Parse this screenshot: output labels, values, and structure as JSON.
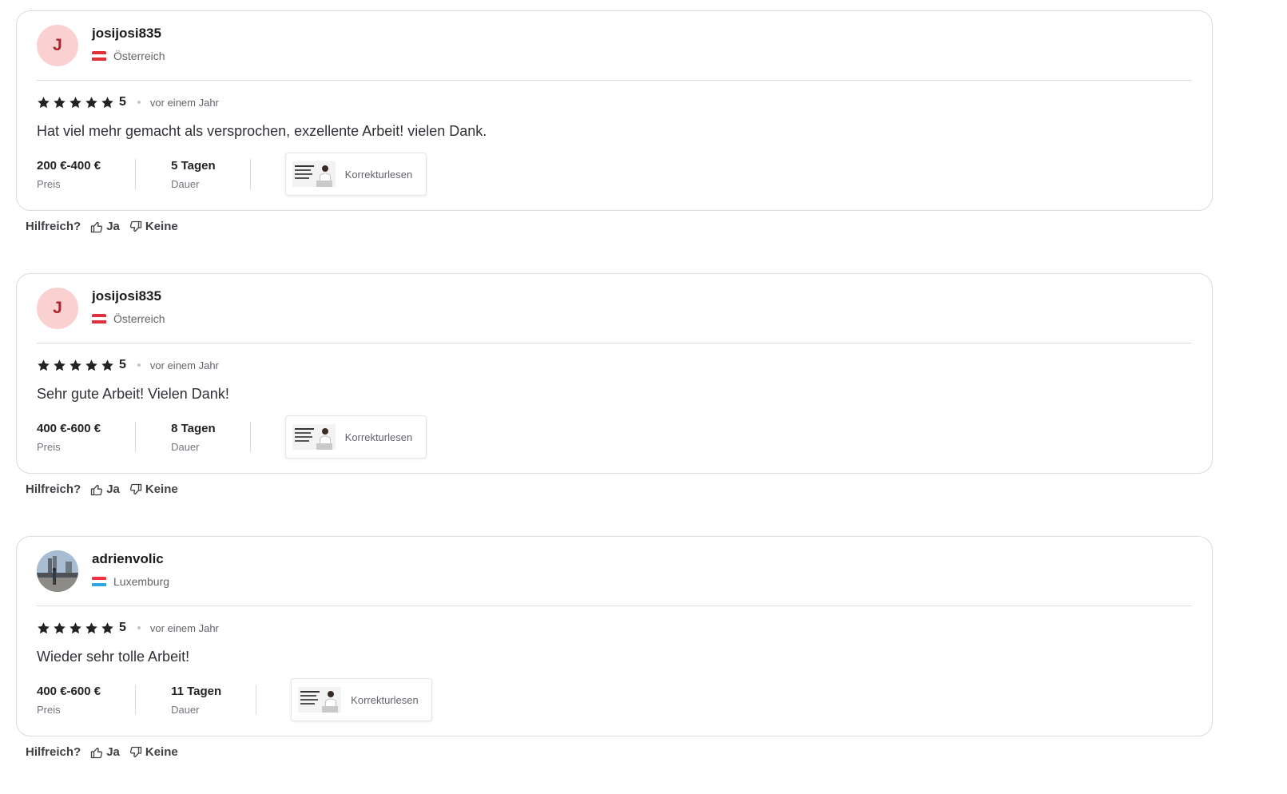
{
  "reviews": [
    {
      "avatar_letter": "J",
      "avatar_type": "letter",
      "username": "josijosi835",
      "country": "Österreich",
      "flag": [
        "#e0303a",
        "#ffffff",
        "#e0303a"
      ],
      "rating": "5",
      "stars": 5,
      "time": "vor einem Jahr",
      "text": "Hat viel mehr gemacht als versprochen, exzellente Arbeit! vielen Dank.",
      "price_value": "200 €-400 €",
      "price_label": "Preis",
      "duration_value": "5 Tagen",
      "duration_label": "Dauer",
      "service": "Korrekturlesen"
    },
    {
      "avatar_letter": "J",
      "avatar_type": "letter",
      "username": "josijosi835",
      "country": "Österreich",
      "flag": [
        "#e0303a",
        "#ffffff",
        "#e0303a"
      ],
      "rating": "5",
      "stars": 5,
      "time": "vor einem Jahr",
      "text": "Sehr gute Arbeit! Vielen Dank!",
      "price_value": "400 €-600 €",
      "price_label": "Preis",
      "duration_value": "8 Tagen",
      "duration_label": "Dauer",
      "service": "Korrekturlesen"
    },
    {
      "avatar_letter": "",
      "avatar_type": "photo",
      "username": "adrienvolic",
      "country": "Luxemburg",
      "flag": [
        "#ef3340",
        "#ffffff",
        "#2fa6e0"
      ],
      "rating": "5",
      "stars": 5,
      "time": "vor einem Jahr",
      "text": "Wieder sehr tolle Arbeit!",
      "price_value": "400 €-600 €",
      "price_label": "Preis",
      "duration_value": "11 Tagen",
      "duration_label": "Dauer",
      "service": "Korrekturlesen"
    }
  ],
  "helpful": {
    "label": "Hilfreich?",
    "yes": "Ja",
    "no": "Keine"
  },
  "icons": {
    "star": "star-icon",
    "thumbs_up": "thumbs-up-icon",
    "thumbs_down": "thumbs-down-icon"
  },
  "colors": {
    "avatar_bg": "#fbd0d0",
    "avatar_text": "#b0222d",
    "star": "#222325"
  }
}
